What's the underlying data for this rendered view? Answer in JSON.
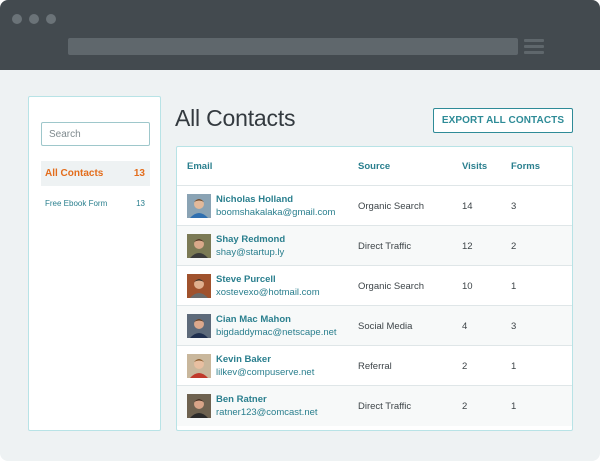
{
  "sidebar": {
    "search_placeholder": "Search",
    "items": [
      {
        "label": "All Contacts",
        "count": "13",
        "active": true
      },
      {
        "label": "Free Ebook Form",
        "count": "13",
        "active": false
      }
    ]
  },
  "main": {
    "title": "All Contacts",
    "export_label": "EXPORT ALL CONTACTS"
  },
  "table": {
    "headers": {
      "email": "Email",
      "source": "Source",
      "visits": "Visits",
      "forms": "Forms"
    },
    "rows": [
      {
        "name": "Nicholas Holland",
        "email": "boomshakalaka@gmail.com",
        "source": "Organic Search",
        "visits": "14",
        "forms": "3"
      },
      {
        "name": "Shay Redmond",
        "email": "shay@startup.ly",
        "source": "Direct Traffic",
        "visits": "12",
        "forms": "2"
      },
      {
        "name": "Steve Purcell",
        "email": "xostevexo@hotmail.com",
        "source": "Organic Search",
        "visits": "10",
        "forms": "1"
      },
      {
        "name": "Cian Mac Mahon",
        "email": "bigdaddymac@netscape.net",
        "source": "Social Media",
        "visits": "4",
        "forms": "3"
      },
      {
        "name": "Kevin Baker",
        "email": "lilkev@compuserve.net",
        "source": "Referral",
        "visits": "2",
        "forms": "1"
      },
      {
        "name": "Ben Ratner",
        "email": "ratner123@comcast.net",
        "source": "Direct Traffic",
        "visits": "2",
        "forms": "1"
      }
    ]
  },
  "colors": {
    "accent": "#2a7f8e",
    "active_orange": "#e36d1c",
    "border": "#b8e3e6",
    "titlebar": "#434a4f"
  }
}
